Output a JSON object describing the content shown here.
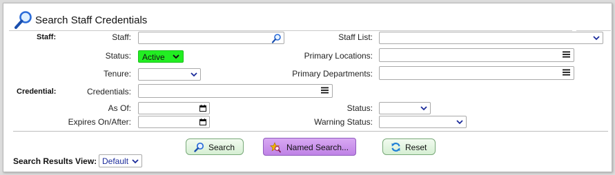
{
  "header": {
    "title": "Search Staff Credentials"
  },
  "staff_section": {
    "heading": "Staff:",
    "staff_label": "Staff:",
    "staff_value": "",
    "status_label": "Status:",
    "status_value": "Active",
    "tenure_label": "Tenure:",
    "tenure_value": "",
    "staff_list_label": "Staff List:",
    "staff_list_value": "",
    "primary_locations_label": "Primary Locations:",
    "primary_locations_value": "",
    "primary_departments_label": "Primary Departments:",
    "primary_departments_value": ""
  },
  "credential_section": {
    "heading": "Credential:",
    "credentials_label": "Credentials:",
    "credentials_value": "",
    "as_of_label": "As Of:",
    "as_of_value": "",
    "expires_label": "Expires On/After:",
    "expires_value": "",
    "status_label": "Status:",
    "status_value": "",
    "warning_status_label": "Warning Status:",
    "warning_status_value": ""
  },
  "actions": {
    "search_label": "Search",
    "named_search_label": "Named Search...",
    "reset_label": "Reset"
  },
  "results_view": {
    "label": "Search Results View:",
    "value": "Default"
  },
  "colors": {
    "status_active": "#22ee22",
    "named_search": "#c98aec",
    "button_green": "#d6efd3",
    "link_blue": "#1a2a9a"
  },
  "icons": {
    "title": "magnifier-icon",
    "staff_lookup": "magnifier-icon",
    "list_picker": "hamburger-menu-icon",
    "date_picker": "calendar-icon",
    "dropdown": "chevron-down-icon",
    "search_button": "magnifier-icon",
    "named_search_button": "star-magnifier-icon",
    "reset_button": "refresh-icon"
  }
}
